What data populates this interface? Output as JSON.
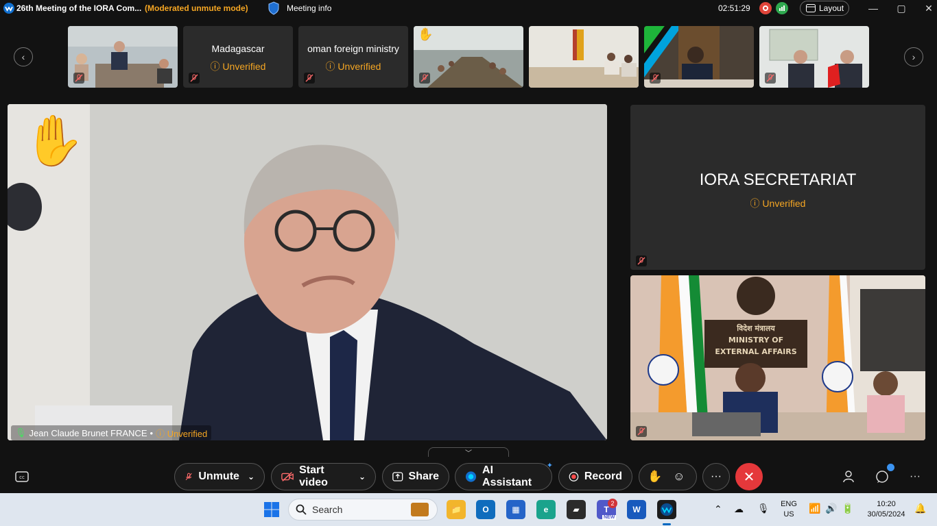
{
  "titlebar": {
    "title": "26th Meeting of the IORA Com...",
    "mode": "(Moderated unmute mode)",
    "meeting_info": "Meeting info",
    "timer": "02:51:29",
    "layout_label": "Layout"
  },
  "filmstrip": {
    "prev_label": "‹",
    "next_label": "›",
    "tiles": [
      {
        "name": "Madagascar",
        "status": "Unverified"
      },
      {
        "name": "oman foreign ministry",
        "status": "Unverified"
      }
    ]
  },
  "main_video": {
    "participant": "Jean Claude Brunet FRANCE",
    "separator": "•",
    "status": "Unverified"
  },
  "side": {
    "secretariat_name": "IORA SECRETARIAT",
    "secretariat_status": "Unverified",
    "india_sign_hindi": "विदेश मंत्रालय",
    "india_sign_line1": "MINISTRY OF",
    "india_sign_line2": "EXTERNAL AFFAIRS"
  },
  "controls": {
    "unmute": "Unmute",
    "start_video": "Start video",
    "share": "Share",
    "ai_assistant": "AI Assistant",
    "record": "Record",
    "more": "···"
  },
  "taskbar": {
    "search_placeholder": "Search",
    "teams_badge": "2",
    "teams_new": "NEW",
    "lang_top": "ENG",
    "lang_bottom": "US",
    "time": "10:20",
    "date": "30/05/2024"
  },
  "colors": {
    "accent_warning": "#f5a623",
    "leave_red": "#e5383b",
    "background": "#121212",
    "tile": "#2b2b2b"
  }
}
